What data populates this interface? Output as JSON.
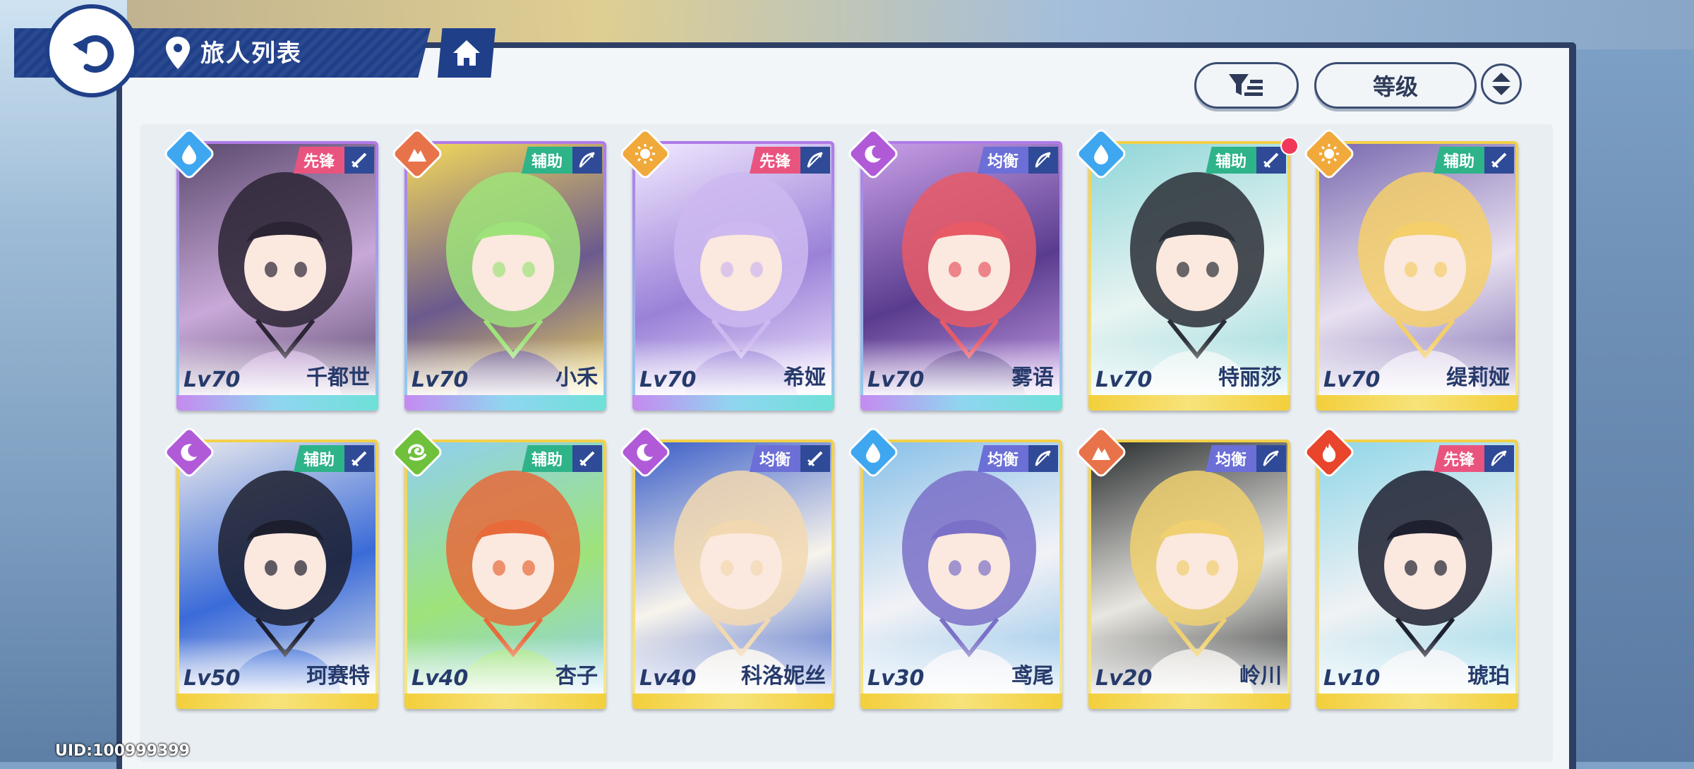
{
  "header": {
    "title": "旅人列表"
  },
  "sort": {
    "label": "等级"
  },
  "uid": "UID:100999399",
  "colors": {
    "vanguard": "#e9547e",
    "support": "#2fb389",
    "balance": "#6b6fd6",
    "water": "#3fa7f0",
    "earth": "#e8734a",
    "sun": "#f0a93a",
    "moon": "#b15ad8",
    "wind": "#6fc13b",
    "fire": "#e8452c"
  },
  "cards": [
    {
      "level": "Lv70",
      "name": "千都世",
      "role": "先锋",
      "element": "water",
      "weapon": "sword",
      "frame": "purple",
      "art": [
        "#2b2434",
        "#5b4a6e",
        "#c8a8d8"
      ],
      "dot": false
    },
    {
      "level": "Lv70",
      "name": "小禾",
      "role": "辅助",
      "element": "earth",
      "weapon": "bow",
      "frame": "purple",
      "art": [
        "#9ee37a",
        "#f4d95a",
        "#6b5a8e"
      ],
      "dot": false
    },
    {
      "level": "Lv70",
      "name": "希娅",
      "role": "先锋",
      "element": "sun",
      "weapon": "bow",
      "frame": "purple",
      "art": [
        "#cdb8f0",
        "#f2e8ff",
        "#9a82d8"
      ],
      "dot": false
    },
    {
      "level": "Lv70",
      "name": "雾语",
      "role": "均衡",
      "element": "moon",
      "weapon": "bow",
      "frame": "purple",
      "art": [
        "#e75a66",
        "#c9a0e8",
        "#5a3c8e"
      ],
      "dot": false
    },
    {
      "level": "Lv70",
      "name": "特丽莎",
      "role": "辅助",
      "element": "water",
      "weapon": "sword",
      "frame": "gold",
      "art": [
        "#2a2e36",
        "#8fd6d8",
        "#e8f4f2"
      ],
      "dot": true
    },
    {
      "level": "Lv70",
      "name": "缇莉娅",
      "role": "辅助",
      "element": "sun",
      "weapon": "sword",
      "frame": "gold",
      "art": [
        "#f4cf6a",
        "#7a6ab0",
        "#e8e0f0"
      ],
      "dot": false
    },
    {
      "level": "Lv50",
      "name": "珂赛特",
      "role": "辅助",
      "element": "moon",
      "weapon": "sword",
      "frame": "gold",
      "art": [
        "#1c1e2e",
        "#e8e8ec",
        "#3a6bd8"
      ],
      "dot": false
    },
    {
      "level": "Lv40",
      "name": "杏子",
      "role": "辅助",
      "element": "wind",
      "weapon": "sword",
      "frame": "gold",
      "art": [
        "#e86a3a",
        "#8fd0f0",
        "#9ee37a"
      ],
      "dot": false
    },
    {
      "level": "Lv40",
      "name": "科洛妮丝",
      "role": "均衡",
      "element": "moon",
      "weapon": "sword",
      "frame": "gold",
      "art": [
        "#f2d8b0",
        "#3a5ec8",
        "#f8f4ec"
      ],
      "dot": false
    },
    {
      "level": "Lv30",
      "name": "鸢尾",
      "role": "均衡",
      "element": "water",
      "weapon": "bow",
      "frame": "gold",
      "art": [
        "#7a70c8",
        "#88c0e8",
        "#f2f2f6"
      ],
      "dot": false
    },
    {
      "level": "Lv20",
      "name": "岭川",
      "role": "均衡",
      "element": "earth",
      "weapon": "bow",
      "frame": "gold",
      "art": [
        "#f0d070",
        "#2a2e30",
        "#e8e6e0"
      ],
      "dot": false
    },
    {
      "level": "Lv10",
      "name": "琥珀",
      "role": "先锋",
      "element": "fire",
      "weapon": "bow",
      "frame": "gold",
      "art": [
        "#1e2030",
        "#8fd6e8",
        "#f0f2f4"
      ],
      "dot": false
    }
  ]
}
